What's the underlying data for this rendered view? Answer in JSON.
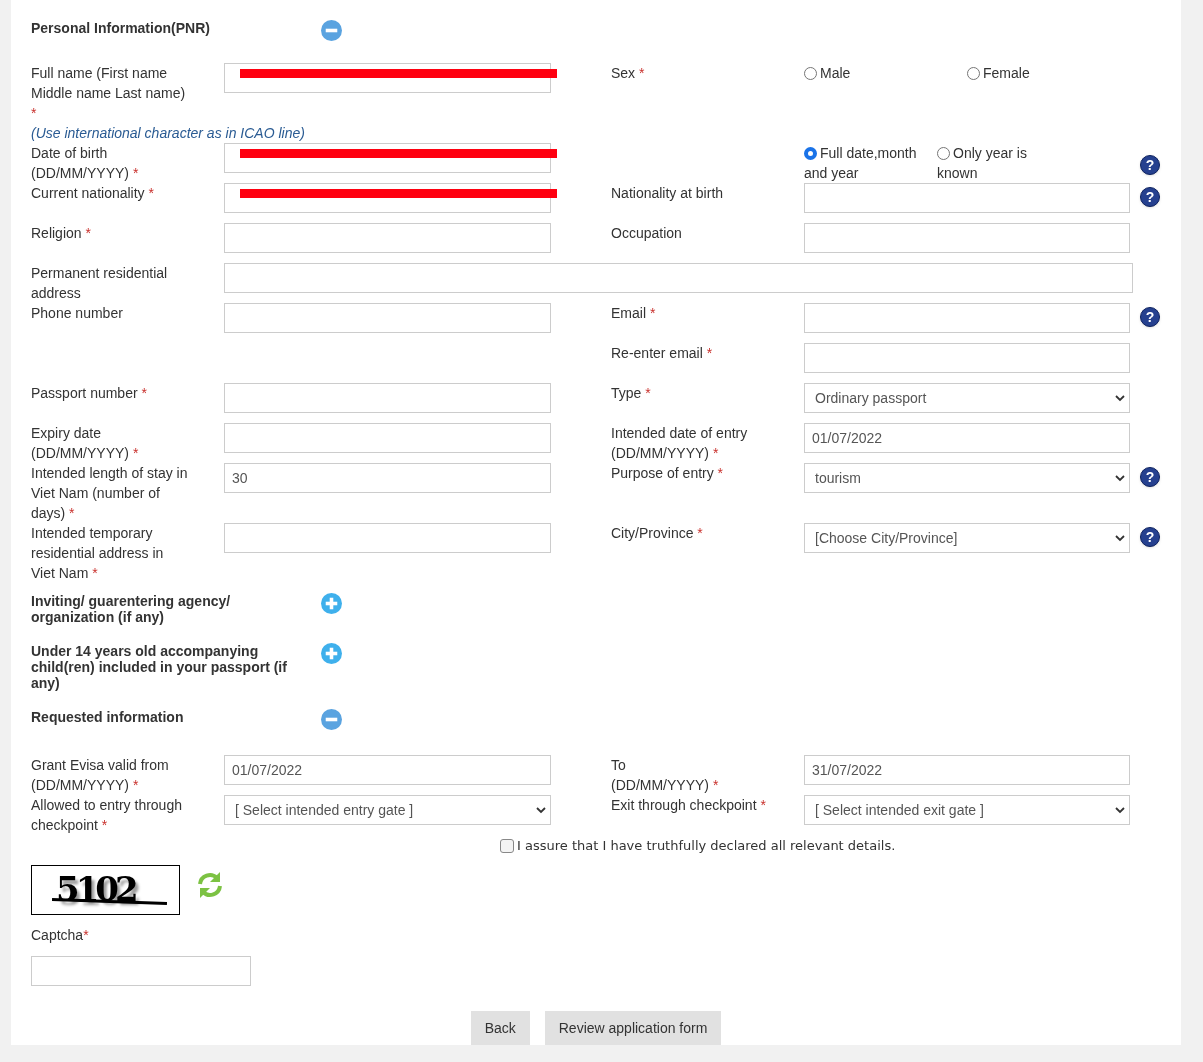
{
  "personal_information": {
    "title": "Personal Information(PNR)",
    "expanded": true,
    "rows": [
      {
        "left": {
          "label": "Full name (First name Middle name Last name)",
          "required_mark": "*",
          "note": "(Use international character as in ICAO line)",
          "kind": "text",
          "redacted": true
        },
        "right": {
          "label": "Sex",
          "required_mark": "*",
          "kind": "radio",
          "options": [
            {
              "label": "Male",
              "selected": false
            },
            {
              "label": "Female",
              "selected": false
            }
          ]
        }
      },
      {
        "left": {
          "label": "Date of birth (DD/MM/YYYY)",
          "required_mark": "*",
          "kind": "text",
          "redacted": true
        },
        "right": {
          "kind": "radio",
          "help": "?",
          "options": [
            {
              "label": "Full date,month and year",
              "selected": true
            },
            {
              "label": "Only year is known",
              "selected": false
            }
          ]
        }
      },
      {
        "left": {
          "label": "Current nationality",
          "required_mark": "*",
          "kind": "text",
          "redacted": true
        },
        "right": {
          "label": "Nationality at birth",
          "kind": "text",
          "help": "?"
        }
      },
      {
        "left": {
          "label": "Religion",
          "required_mark": "*",
          "kind": "text"
        },
        "right": {
          "label": "Occupation",
          "kind": "text"
        }
      },
      {
        "left": {
          "label": "Permanent residential address",
          "kind": "wide"
        }
      },
      {
        "left": {
          "label": "Phone number",
          "kind": "text"
        },
        "right": {
          "label": "Email",
          "required_mark": "*",
          "kind": "text",
          "help": "?"
        }
      },
      {
        "right": {
          "label": "Re-enter email",
          "required_mark": "*",
          "kind": "text"
        }
      },
      {
        "left": {
          "label": "Passport number",
          "required_mark": "*",
          "kind": "text"
        },
        "right": {
          "label": "Type",
          "required_mark": "*",
          "kind": "select",
          "value": "Ordinary passport"
        }
      },
      {
        "left": {
          "label": "Expiry date (DD/MM/YYYY)",
          "required_mark": "*",
          "kind": "text"
        },
        "right": {
          "label": "Intended date of entry (DD/MM/YYYY)",
          "required_mark": "*",
          "kind": "text",
          "value": "01/07/2022"
        }
      },
      {
        "left": {
          "label": "Intended length of stay in Viet Nam (number of days)",
          "required_mark": "*",
          "kind": "text",
          "value": "30"
        },
        "right": {
          "label": "Purpose of entry",
          "required_mark": "*",
          "kind": "select",
          "value": "tourism",
          "help": "?"
        }
      },
      {
        "left": {
          "label": "Intended temporary residential address in Viet Nam",
          "required_mark": "*",
          "kind": "text"
        },
        "right": {
          "label": "City/Province",
          "required_mark": "*",
          "kind": "select",
          "value": "[Choose City/Province]",
          "help": "?"
        }
      }
    ]
  },
  "inviting_agency": {
    "title": "Inviting/ guarentering agency/ organization (if any)",
    "expanded": false
  },
  "accompanying_children": {
    "title": "Under 14 years old accompanying child(ren) included in your passport (if any)",
    "expanded": false
  },
  "requested_information": {
    "title": "Requested information",
    "expanded": true,
    "rows": [
      {
        "left": {
          "label": "Grant Evisa valid from (DD/MM/YYYY)",
          "required_mark": "*",
          "kind": "text",
          "value": "01/07/2022"
        },
        "right": {
          "label": "To\n(DD/MM/YYYY)",
          "required_mark": "*",
          "kind": "text",
          "value": "31/07/2022"
        }
      },
      {
        "left": {
          "label": "Allowed to entry through checkpoint",
          "required_mark": "*",
          "kind": "select",
          "value": "[ Select intended entry gate ]"
        },
        "right": {
          "label": "Exit through checkpoint",
          "required_mark": "*",
          "kind": "select",
          "value": "[ Select intended exit gate ]"
        }
      }
    ]
  },
  "declaration": {
    "label": "I assure that I have truthfully declared all relevant details.",
    "checked": false
  },
  "captcha": {
    "image_text": "5102",
    "label": "Captcha",
    "required_mark": "*"
  },
  "buttons": [
    {
      "label": "Back"
    },
    {
      "label": "Review application form"
    }
  ]
}
